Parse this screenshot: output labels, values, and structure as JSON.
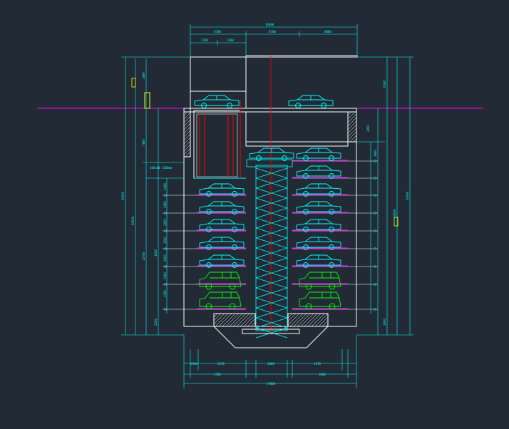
{
  "colors": {
    "background": "#222b35",
    "structure": "#ffffff",
    "dimension": "#00ffff",
    "car": "#00ffff",
    "suv": "#00ff00",
    "ground": "#ff00ff",
    "lift": "#ff0000",
    "label": "#ffff00"
  },
  "dims": {
    "top_total": "16600",
    "top_left": "8700",
    "top_mid": "8700",
    "top_right": "8000",
    "top_sub_a": "2700",
    "top_sub_b": "2300",
    "left_total": "38300",
    "left_inner": "30600",
    "right_total": "38300",
    "right_inner": "32800",
    "left_upper": "7800",
    "left_top": "2800",
    "left_lower": "12700",
    "left_bottom": "2200",
    "left_gap": "3200",
    "right_top": "6300",
    "right_upper": "2850",
    "right_mid": "4800",
    "right_bottom": "3000",
    "level_pitch": "2000",
    "bottom_a": "3900",
    "bottom_b": "5570",
    "bottom_c": "2800",
    "bottom_d": "5570",
    "bottom_e": "4500",
    "bottom_f": "3000",
    "bottom_total": "17000",
    "note": "100x80 1500mm"
  }
}
